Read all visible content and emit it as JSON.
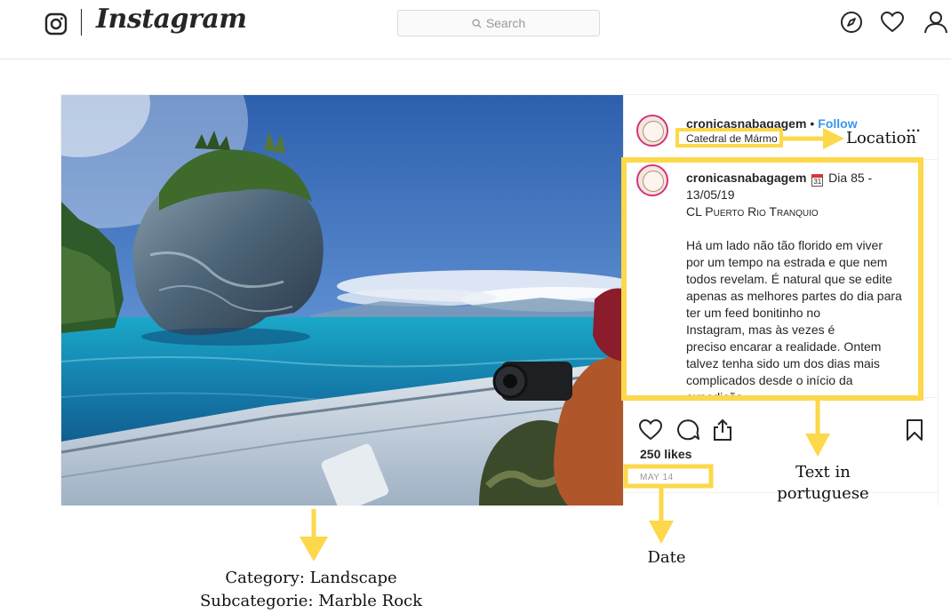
{
  "nav": {
    "logo_text": "Instagram",
    "search_placeholder": "Search"
  },
  "post": {
    "username": "cronicasnabagagem",
    "separator": "•",
    "follow_label": "Follow",
    "location": "Catedral de Mármo",
    "more_label": "...",
    "caption": {
      "username": "cronicasnabagagem",
      "calendar_day": "31",
      "line1": "Dia 85 - 13/05/19",
      "line2": "CL Puerto Rio Tranquio",
      "lines": [
        "Há um lado não tão florido em viver",
        "por um tempo na estrada e que nem",
        "todos revelam. É natural que se edite",
        "apenas as melhores partes do dia para",
        "ter um feed bonitinho no",
        "Instagram, mas às vezes é",
        "preciso encarar a realidade. Ontem",
        "talvez tenha sido um dos dias mais",
        "complicados desde o início da",
        "expedição"
      ]
    },
    "likes": "250 likes",
    "date": "MAY 14"
  },
  "annotations": {
    "location": "Location",
    "text": [
      "Text in",
      "portuguese"
    ],
    "date": "Date",
    "category": "Category: Landscape",
    "subcategory": "Subcategorie: Marble Rock"
  },
  "colors": {
    "accent_blue": "#3897f0",
    "annotation_yellow": "#fcd84a",
    "text": "#262626"
  },
  "icons": [
    "instagram-camera-icon",
    "search-icon",
    "compass-icon",
    "heart-icon",
    "profile-icon",
    "comment-icon",
    "share-icon",
    "bookmark-icon",
    "calendar-icon"
  ]
}
